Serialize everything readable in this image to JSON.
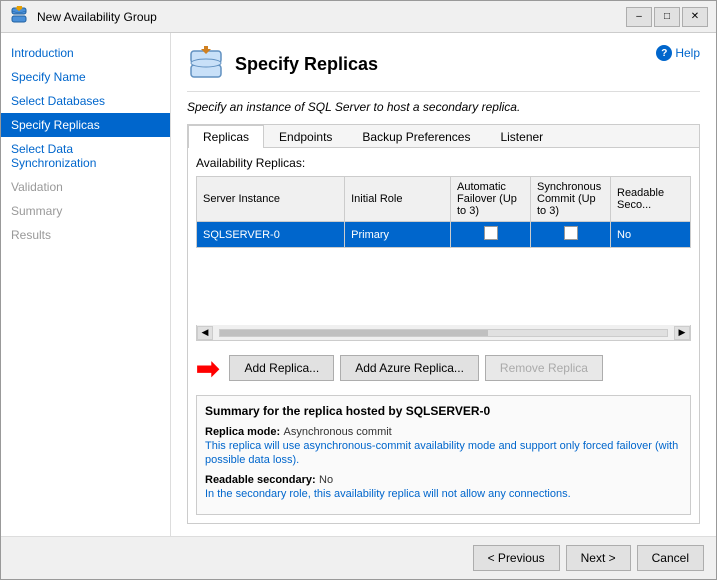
{
  "window": {
    "title": "New Availability Group",
    "help_label": "Help"
  },
  "sidebar": {
    "items": [
      {
        "id": "introduction",
        "label": "Introduction",
        "state": "normal"
      },
      {
        "id": "specify-name",
        "label": "Specify Name",
        "state": "normal"
      },
      {
        "id": "select-databases",
        "label": "Select Databases",
        "state": "normal"
      },
      {
        "id": "specify-replicas",
        "label": "Specify Replicas",
        "state": "active"
      },
      {
        "id": "select-data-sync",
        "label": "Select Data Synchronization",
        "state": "normal"
      },
      {
        "id": "validation",
        "label": "Validation",
        "state": "disabled"
      },
      {
        "id": "summary",
        "label": "Summary",
        "state": "disabled"
      },
      {
        "id": "results",
        "label": "Results",
        "state": "disabled"
      }
    ]
  },
  "header": {
    "page_title": "Specify Replicas",
    "description": "Specify an instance of SQL Server to host a secondary replica."
  },
  "tabs": [
    {
      "id": "replicas",
      "label": "Replicas",
      "active": true
    },
    {
      "id": "endpoints",
      "label": "Endpoints",
      "active": false
    },
    {
      "id": "backup-preferences",
      "label": "Backup Preferences",
      "active": false
    },
    {
      "id": "listener",
      "label": "Listener",
      "active": false
    }
  ],
  "table": {
    "section_label": "Availability Replicas:",
    "columns": [
      {
        "id": "server-instance",
        "label": "Server Instance"
      },
      {
        "id": "initial-role",
        "label": "Initial Role"
      },
      {
        "id": "auto-failover",
        "label": "Automatic Failover (Up to 3)"
      },
      {
        "id": "sync-commit",
        "label": "Synchronous Commit (Up to 3)"
      },
      {
        "id": "readable-secondary",
        "label": "Readable Seco..."
      }
    ],
    "rows": [
      {
        "server_instance": "SQLSERVER-0",
        "initial_role": "Primary",
        "auto_failover": false,
        "sync_commit": false,
        "readable_secondary": "No",
        "selected": true
      }
    ]
  },
  "buttons": {
    "add_replica": "Add Replica...",
    "add_azure_replica": "Add Azure Replica...",
    "remove_replica": "Remove Replica"
  },
  "summary": {
    "title": "Summary for the replica hosted by SQLSERVER-0",
    "replica_mode_label": "Replica mode:",
    "replica_mode_value": "Asynchronous commit",
    "replica_mode_detail": "This replica will use asynchronous-commit availability mode and support only forced failover (with possible data loss).",
    "readable_secondary_label": "Readable secondary:",
    "readable_secondary_value": "No",
    "readable_secondary_detail": "In the secondary role, this availability replica will not allow any connections."
  },
  "footer": {
    "previous_label": "< Previous",
    "next_label": "Next >",
    "cancel_label": "Cancel"
  }
}
